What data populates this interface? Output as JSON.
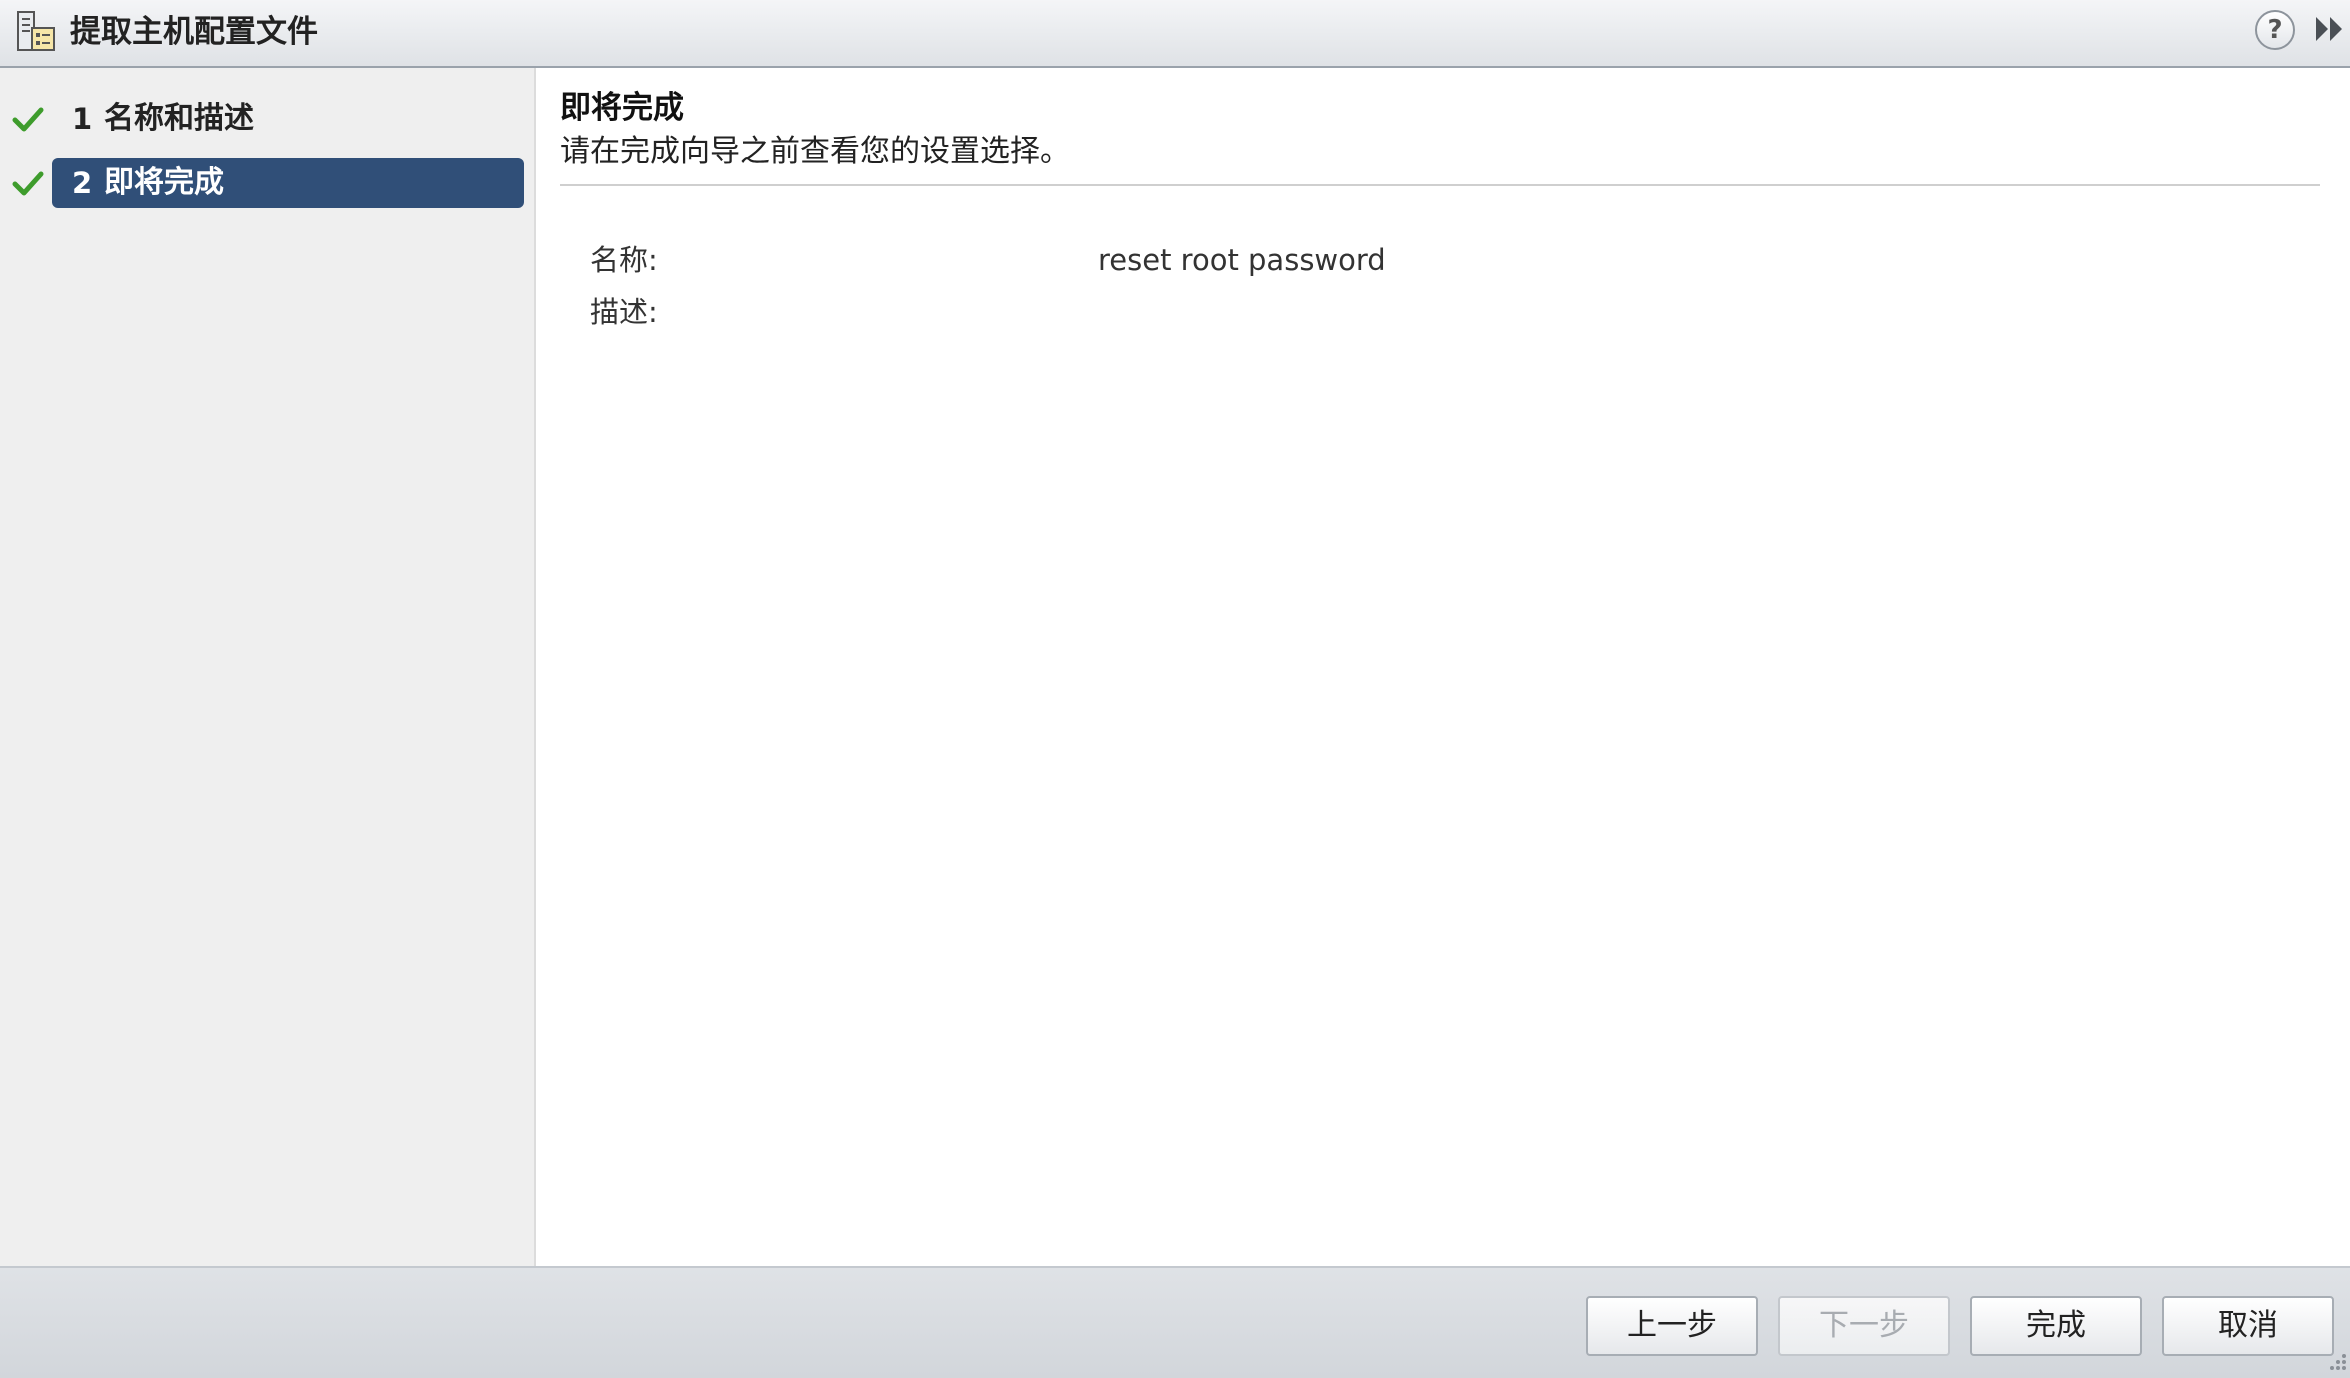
{
  "window": {
    "title": "提取主机配置文件",
    "icons": {
      "app": "host-profile-icon",
      "help": "help-icon",
      "expand": "double-chevron-right-icon"
    },
    "help_glyph": "?"
  },
  "steps": [
    {
      "number": "1",
      "label": "名称和描述",
      "status": "completed",
      "selected": false
    },
    {
      "number": "2",
      "label": "即将完成",
      "status": "completed",
      "selected": true
    }
  ],
  "content": {
    "title": "即将完成",
    "subtitle": "请在完成向导之前查看您的设置选择。",
    "fields": [
      {
        "label": "名称:",
        "value": "reset root password"
      },
      {
        "label": "描述:",
        "value": ""
      }
    ]
  },
  "buttons": {
    "back": "上一步",
    "next": "下一步",
    "finish": "完成",
    "cancel": "取消"
  },
  "colors": {
    "selected_step": "#304f78",
    "check": "#3e9c2c",
    "sidebar_bg": "#efefef"
  }
}
